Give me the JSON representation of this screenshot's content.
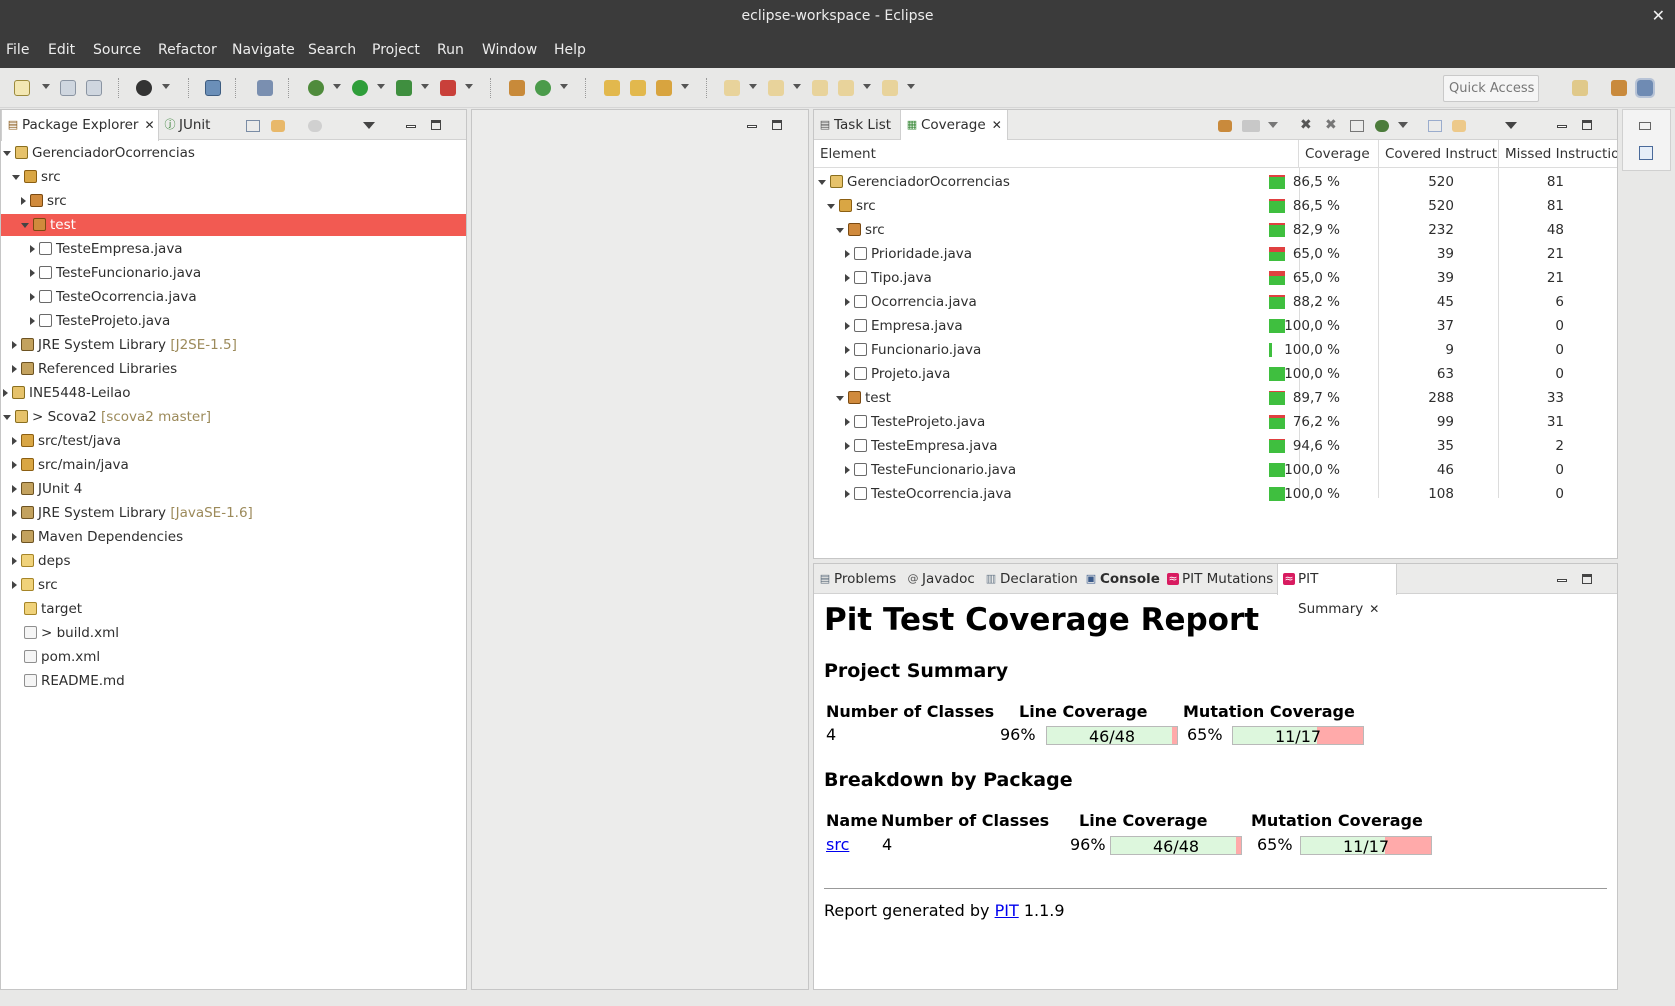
{
  "window": {
    "title": "eclipse-workspace - Eclipse",
    "close_glyph": "✕"
  },
  "menu": [
    "File",
    "Edit",
    "Source",
    "Refactor",
    "Navigate",
    "Search",
    "Project",
    "Run",
    "Window",
    "Help"
  ],
  "toolbar": {
    "quick_access": "Quick Access"
  },
  "package_explorer": {
    "tabs": [
      {
        "label": "Package Explorer",
        "active": true,
        "closable": true
      },
      {
        "label": "JUnit",
        "active": false,
        "closable": false
      }
    ],
    "tree": [
      {
        "label": "GerenciadorOcorrencias",
        "decor": "",
        "expanded": true,
        "icon": "project-icon"
      },
      {
        "label": "src",
        "decor": "",
        "expanded": true,
        "icon": "source-folder-icon"
      },
      {
        "label": "src",
        "decor": "",
        "expanded": false,
        "icon": "package-icon"
      },
      {
        "label": "test",
        "decor": "",
        "expanded": true,
        "icon": "package-icon",
        "selected": true
      },
      {
        "label": "TesteEmpresa.java",
        "decor": "",
        "expanded": false,
        "icon": "java-file-icon"
      },
      {
        "label": "TesteFuncionario.java",
        "decor": "",
        "expanded": false,
        "icon": "java-file-icon"
      },
      {
        "label": "TesteOcorrencia.java",
        "decor": "",
        "expanded": false,
        "icon": "java-file-icon"
      },
      {
        "label": "TesteProjeto.java",
        "decor": "",
        "expanded": false,
        "icon": "java-file-icon"
      },
      {
        "label": "JRE System Library",
        "decor": "[J2SE-1.5]",
        "expanded": false,
        "icon": "library-icon"
      },
      {
        "label": "Referenced Libraries",
        "decor": "",
        "expanded": false,
        "icon": "library-icon"
      },
      {
        "label": "INE5448-Leilao",
        "decor": "",
        "expanded": false,
        "icon": "project-icon"
      },
      {
        "label": "> Scova2",
        "decor": "[scova2 master]",
        "expanded": true,
        "icon": "maven-project-icon"
      },
      {
        "label": "src/test/java",
        "decor": "",
        "expanded": false,
        "icon": "source-folder-icon"
      },
      {
        "label": "src/main/java",
        "decor": "",
        "expanded": false,
        "icon": "source-folder-icon"
      },
      {
        "label": "JUnit 4",
        "decor": "",
        "expanded": false,
        "icon": "library-icon"
      },
      {
        "label": "JRE System Library",
        "decor": "[JavaSE-1.6]",
        "expanded": false,
        "icon": "library-icon"
      },
      {
        "label": "Maven Dependencies",
        "decor": "",
        "expanded": false,
        "icon": "library-icon"
      },
      {
        "label": "deps",
        "decor": "",
        "expanded": false,
        "icon": "folder-icon"
      },
      {
        "label": "src",
        "decor": "",
        "expanded": false,
        "icon": "folder-icon"
      },
      {
        "label": "target",
        "decor": "",
        "expanded": null,
        "icon": "folder-icon"
      },
      {
        "label": "> build.xml",
        "decor": "",
        "expanded": null,
        "icon": "xml-file-icon"
      },
      {
        "label": "pom.xml",
        "decor": "",
        "expanded": null,
        "icon": "xml-file-icon"
      },
      {
        "label": "README.md",
        "decor": "",
        "expanded": null,
        "icon": "file-icon"
      }
    ]
  },
  "coverage_view": {
    "tabs": [
      {
        "label": "Task List",
        "active": false,
        "closable": false
      },
      {
        "label": "Coverage",
        "active": true,
        "closable": true
      }
    ],
    "columns": [
      "Element",
      "Coverage",
      "Covered Instructi",
      "Missed Instructior"
    ],
    "rows": [
      {
        "label": "GerenciadorOcorrencias",
        "coverage": "86,5 %",
        "covered": "520",
        "missed": "81",
        "ratio": 0.865,
        "expanded": true,
        "icon": "project-icon"
      },
      {
        "label": "src",
        "coverage": "86,5 %",
        "covered": "520",
        "missed": "81",
        "ratio": 0.865,
        "expanded": true,
        "icon": "source-folder-icon"
      },
      {
        "label": "src",
        "coverage": "82,9 %",
        "covered": "232",
        "missed": "48",
        "ratio": 0.829,
        "expanded": true,
        "icon": "package-icon"
      },
      {
        "label": "Prioridade.java",
        "coverage": "65,0 %",
        "covered": "39",
        "missed": "21",
        "ratio": 0.65,
        "expanded": false,
        "icon": "java-file-icon"
      },
      {
        "label": "Tipo.java",
        "coverage": "65,0 %",
        "covered": "39",
        "missed": "21",
        "ratio": 0.65,
        "expanded": false,
        "icon": "java-file-icon"
      },
      {
        "label": "Ocorrencia.java",
        "coverage": "88,2 %",
        "covered": "45",
        "missed": "6",
        "ratio": 0.882,
        "expanded": false,
        "icon": "java-file-icon"
      },
      {
        "label": "Empresa.java",
        "coverage": "100,0 %",
        "covered": "37",
        "missed": "0",
        "ratio": 1.0,
        "expanded": false,
        "icon": "java-file-icon"
      },
      {
        "label": "Funcionario.java",
        "coverage": "100,0 %",
        "covered": "9",
        "missed": "0",
        "ratio": 1.0,
        "expanded": false,
        "icon": "java-file-icon"
      },
      {
        "label": "Projeto.java",
        "coverage": "100,0 %",
        "covered": "63",
        "missed": "0",
        "ratio": 1.0,
        "expanded": false,
        "icon": "java-file-icon"
      },
      {
        "label": "test",
        "coverage": "89,7 %",
        "covered": "288",
        "missed": "33",
        "ratio": 0.897,
        "expanded": true,
        "icon": "package-icon"
      },
      {
        "label": "TesteProjeto.java",
        "coverage": "76,2 %",
        "covered": "99",
        "missed": "31",
        "ratio": 0.762,
        "expanded": false,
        "icon": "java-file-icon"
      },
      {
        "label": "TesteEmpresa.java",
        "coverage": "94,6 %",
        "covered": "35",
        "missed": "2",
        "ratio": 0.946,
        "expanded": false,
        "icon": "java-file-icon"
      },
      {
        "label": "TesteFuncionario.java",
        "coverage": "100,0 %",
        "covered": "46",
        "missed": "0",
        "ratio": 1.0,
        "expanded": false,
        "icon": "java-file-icon"
      },
      {
        "label": "TesteOcorrencia.java",
        "coverage": "100,0 %",
        "covered": "108",
        "missed": "0",
        "ratio": 1.0,
        "expanded": false,
        "icon": "java-file-icon"
      }
    ]
  },
  "bottom_panel": {
    "tabs": [
      {
        "label": "Problems",
        "active": false,
        "closable": false,
        "icon": "problems-icon"
      },
      {
        "label": "Javadoc",
        "active": false,
        "closable": false,
        "icon": "at-icon"
      },
      {
        "label": "Declaration",
        "active": false,
        "closable": false,
        "icon": "declaration-icon"
      },
      {
        "label": "Console",
        "active": false,
        "closable": false,
        "icon": "console-icon",
        "bold": true
      },
      {
        "label": "PIT Mutations",
        "active": false,
        "closable": false,
        "icon": "pit-icon"
      },
      {
        "label": "PIT Summary",
        "active": true,
        "closable": true,
        "icon": "pit-icon"
      }
    ],
    "report": {
      "title": "Pit Test Coverage Report",
      "project_summary": {
        "heading": "Project Summary",
        "headers": [
          "Number of Classes",
          "Line Coverage",
          "Mutation Coverage"
        ],
        "classes": "4",
        "line_pct": "96%",
        "line_ratio": "46/48",
        "line_fraction": 0.9583,
        "mutation_pct": "65%",
        "mutation_ratio": "11/17",
        "mutation_fraction": 0.647
      },
      "breakdown": {
        "heading": "Breakdown by Package",
        "headers": [
          "Name",
          "Number of Classes",
          "Line Coverage",
          "Mutation Coverage"
        ],
        "rows": [
          {
            "name": "src",
            "classes": "4",
            "line_pct": "96%",
            "line_ratio": "46/48",
            "line_fraction": 0.9583,
            "mutation_pct": "65%",
            "mutation_ratio": "11/17",
            "mutation_fraction": 0.647
          }
        ]
      },
      "footer_prefix": "Report generated by",
      "footer_link": "PIT",
      "footer_version": "1.1.9"
    }
  },
  "colors": {
    "selection": "#f25a52",
    "covered": "#3fbf3f",
    "missed": "#e04040",
    "pit_green": "#ddf7dd",
    "pit_red": "#ffaaaa"
  }
}
